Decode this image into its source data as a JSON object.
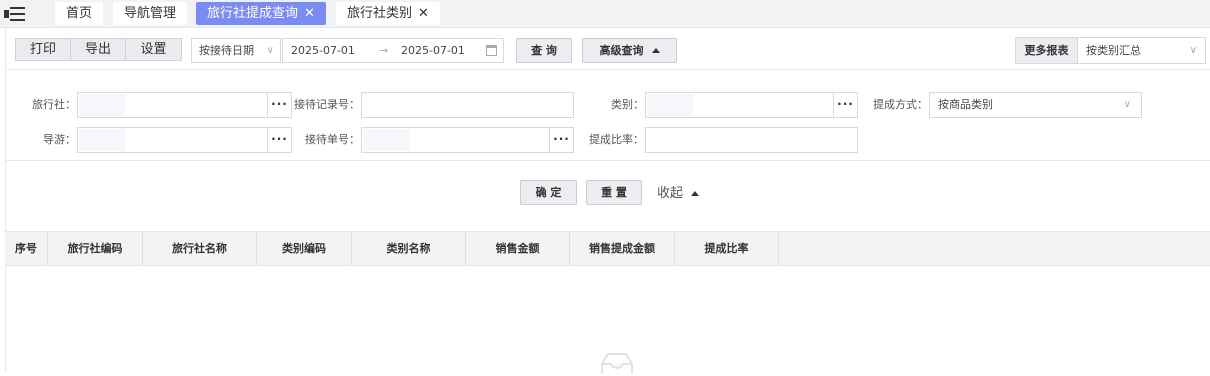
{
  "tabs": [
    {
      "label": "首页",
      "closable": false,
      "active": false
    },
    {
      "label": "导航管理",
      "closable": false,
      "active": false
    },
    {
      "label": "旅行社提成查询",
      "closable": true,
      "active": true
    },
    {
      "label": "旅行社类别",
      "closable": true,
      "active": false
    }
  ],
  "toolbar": {
    "print": "打印",
    "export": "导出",
    "settings": "设置",
    "date_type": "按接待日期",
    "date_start": "2025-07-01",
    "date_end": "2025-07-01",
    "date_sep": "→",
    "query": "查 询",
    "advanced": "高级查询",
    "more_reports_label": "更多报表",
    "more_reports_value": "按类别汇总"
  },
  "filters": {
    "agency_label": "旅行社：",
    "record_no_label": "接待记录号：",
    "category_label": "类别：",
    "commission_method_label": "提成方式：",
    "commission_method_value": "按商品类别",
    "guide_label": "导游：",
    "order_no_label": "接待单号：",
    "commission_rate_label": "提成比率："
  },
  "actions": {
    "confirm": "确 定",
    "reset": "重 置",
    "collapse": "收起"
  },
  "table": {
    "columns": [
      "序号",
      "旅行社编码",
      "旅行社名称",
      "类别编码",
      "类别名称",
      "销售金额",
      "销售提成金额",
      "提成比率"
    ],
    "rows": []
  },
  "colors": {
    "active_tab": "#7a8cf2",
    "header_bg": "#f2f3f5"
  }
}
